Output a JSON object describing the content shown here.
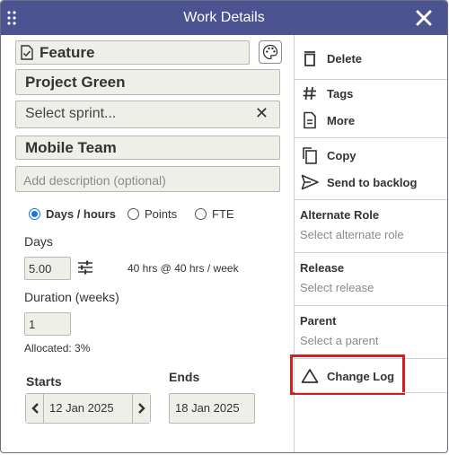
{
  "dialog": {
    "title": "Work Details"
  },
  "form": {
    "type_label": "Feature",
    "project": "Project Green",
    "sprint_placeholder": "Select sprint...",
    "sprint_clear": "✕",
    "team": "Mobile Team",
    "description_placeholder": "Add description (optional)",
    "units": {
      "options": [
        "Days / hours",
        "Points",
        "FTE"
      ],
      "selected": "Days / hours"
    },
    "days_label": "Days",
    "days_value": "5.00",
    "hours_text": "40 hrs @ 40 hrs / week",
    "duration_label": "Duration (weeks)",
    "duration_value": "1",
    "allocated": "Allocated: 3%",
    "starts_label": "Starts",
    "starts_value": "12 Jan 2025",
    "ends_label": "Ends",
    "ends_value": "18 Jan 2025"
  },
  "sidebar": {
    "delete": "Delete",
    "tags": "Tags",
    "more": "More",
    "copy": "Copy",
    "send_to_backlog": "Send to backlog",
    "alternate_role": {
      "label": "Alternate Role",
      "placeholder": "Select alternate role"
    },
    "release": {
      "label": "Release",
      "placeholder": "Select release"
    },
    "parent": {
      "label": "Parent",
      "placeholder": "Select a parent"
    },
    "change_log": "Change Log"
  },
  "colors": {
    "titlebar": "#4b5390",
    "field_bg": "#efefe9",
    "highlight_border": "#d41f1f",
    "radio_selected": "#1a73e8"
  },
  "icons": [
    "drag-handle-icon",
    "close-icon",
    "checklist-icon",
    "palette-icon",
    "adjust-icon",
    "chevron-left-icon",
    "chevron-right-icon",
    "trash-icon",
    "hash-icon",
    "document-icon",
    "copy-icon",
    "send-icon",
    "triangle-icon"
  ]
}
